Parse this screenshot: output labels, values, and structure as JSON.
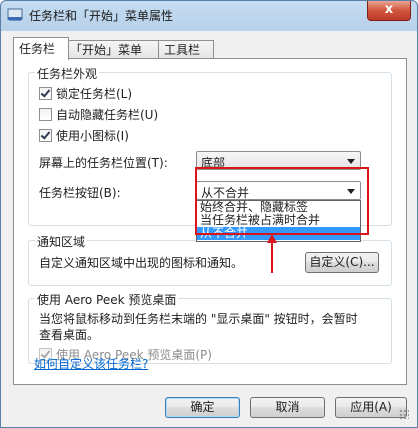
{
  "window": {
    "title": "任务栏和「开始」菜单属性",
    "close_label": "x"
  },
  "tabs": [
    {
      "label": "任务栏",
      "active": true
    },
    {
      "label": "「开始」菜单",
      "active": false
    },
    {
      "label": "工具栏",
      "active": false
    }
  ],
  "appearance": {
    "legend": "任务栏外观",
    "lock": {
      "label": "锁定任务栏(L)",
      "checked": true
    },
    "autohide": {
      "label": "自动隐藏任务栏(U)",
      "checked": false
    },
    "small_icons": {
      "label": "使用小图标(I)",
      "checked": true
    },
    "position_label": "屏幕上的任务栏位置(T):",
    "position_value": "底部",
    "buttons_label": "任务栏按钮(B):",
    "buttons_value": "从不合并",
    "buttons_options": [
      "始终合并、隐藏标签",
      "当任务栏被占满时合并",
      "从不合并"
    ]
  },
  "notification": {
    "legend": "通知区域",
    "desc": "自定义通知区域中出现的图标和通知。",
    "customize_label": "自定义(C)..."
  },
  "aero": {
    "legend": "使用 Aero Peek 预览桌面",
    "desc_line1": "当您将鼠标移动到任务栏末端的 \"显示桌面\" 按钮时，会暂时",
    "desc_line2": "查看桌面。",
    "checkbox_label": "使用 Aero Peek 预览桌面(P)",
    "checked": true
  },
  "help_link": "如何自定义该任务栏?",
  "footer": {
    "ok": "确定",
    "cancel": "取消",
    "apply": "应用(A)"
  },
  "colors": {
    "highlight_box": "#d9141b",
    "selection": "#3399ff",
    "link": "#0066cc"
  }
}
